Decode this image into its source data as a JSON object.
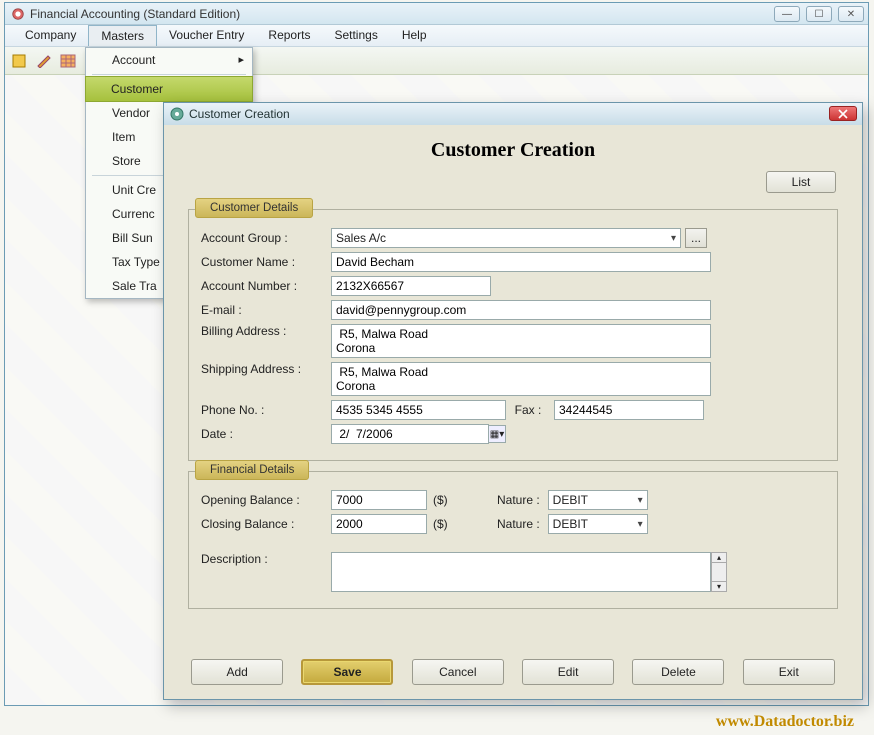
{
  "app": {
    "title": "Financial Accounting (Standard Edition)"
  },
  "menubar": [
    "Company",
    "Masters",
    "Voucher Entry",
    "Reports",
    "Settings",
    "Help"
  ],
  "masters_menu": {
    "account": "Account",
    "items": [
      "Customer",
      "Vendor",
      "Item",
      "Store"
    ],
    "items2": [
      "Unit Cre",
      "Currenc",
      "Bill Sun",
      "Tax Type",
      "Sale Tra"
    ]
  },
  "modal": {
    "title": "Customer Creation",
    "heading": "Customer Creation",
    "list_btn": "List",
    "customer_details_legend": "Customer Details",
    "financial_details_legend": "Financial Details",
    "labels": {
      "account_group": "Account Group :",
      "customer_name": "Customer Name :",
      "account_number": "Account Number :",
      "email": "E-mail :",
      "billing_address": "Billing Address :",
      "shipping_address": "Shipping Address :",
      "phone": "Phone No. :",
      "fax": "Fax :",
      "date": "Date :",
      "opening_balance": "Opening Balance :",
      "closing_balance": "Closing Balance :",
      "nature": "Nature :",
      "description": "Description :",
      "currency": "($)"
    },
    "values": {
      "account_group": "Sales A/c",
      "customer_name": "David Becham",
      "account_number": "2132X66567",
      "email": "david@pennygroup.com",
      "billing_address": " R5, Malwa Road\nCorona",
      "shipping_address": " R5, Malwa Road\nCorona",
      "phone": "4535 5345 4555",
      "fax": "34244545",
      "date": " 2/  7/2006",
      "opening_balance": "7000",
      "closing_balance": "2000",
      "nature_open": "DEBIT",
      "nature_close": "DEBIT",
      "description": ""
    },
    "buttons": {
      "add": "Add",
      "save": "Save",
      "cancel": "Cancel",
      "edit": "Edit",
      "delete": "Delete",
      "exit": "Exit",
      "ellipsis": "..."
    }
  },
  "watermark": "www.Datadoctor.biz"
}
